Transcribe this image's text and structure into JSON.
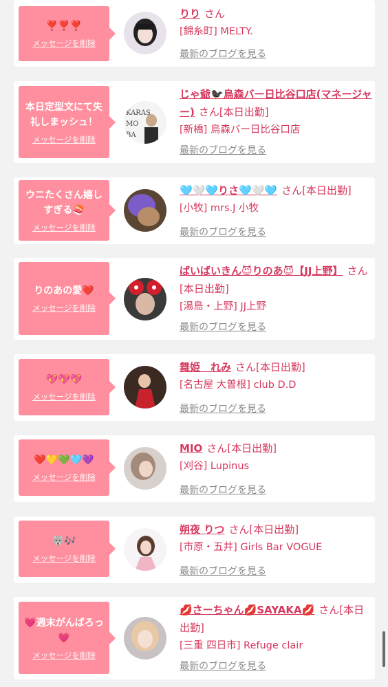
{
  "delete_label": "メッセージを削除",
  "blog_label": "最新のブログを見る",
  "san": "さん",
  "cards": [
    {
      "message": "❣️❣️❣️",
      "name": "りり",
      "suffix": "さん",
      "shop": "[錦糸町] MELTY."
    },
    {
      "message": "本日定型文にて失礼しまッシュ！",
      "name": "じゃ爺🐦‍⬛烏森バー日比谷口店(マネージャー)",
      "suffix": "さん[本日出勤]",
      "shop": "[新橋] 烏森バー日比谷口店"
    },
    {
      "message": "ウニたくさん嬉しすぎる🍣",
      "name": "🩵🤍🩵りさ🩵🤍🩵",
      "suffix": "さん[本日出勤]",
      "shop": "[小牧] mrs.J 小牧"
    },
    {
      "message": "りのあの愛❤️",
      "name": "ばいばいきん😈りのあ😈【JJ上野】",
      "suffix": "さん[本日出勤]",
      "shop": "[湯島・上野] JJ上野"
    },
    {
      "message": "💖💖💖",
      "name": "舞姫　れみ",
      "suffix": "さん[本日出勤]",
      "shop": "[名古屋 大曽根] club D.D"
    },
    {
      "message": "❤️💛💚🩵💜",
      "name": "MIO",
      "suffix": "さん[本日出勤]",
      "shop": "[刈谷] Lupinus"
    },
    {
      "message": "🐺🎶",
      "name": "朔夜 りつ",
      "suffix": "さん[本日出勤]",
      "shop": "[市原・五井] Girls Bar VOGUE"
    },
    {
      "message": "💗週末がんばろっ💗",
      "name": "💋さーちゃん💋SAYAKA💋",
      "suffix": "さん[本日出勤]",
      "shop": "[三重 四日市] Refuge clair"
    }
  ],
  "colors": {
    "accent": "#d6385d",
    "bubble": "#ff8f9e",
    "link_gray": "#8a8a8a"
  },
  "icons": [
    "avatar-photo"
  ]
}
